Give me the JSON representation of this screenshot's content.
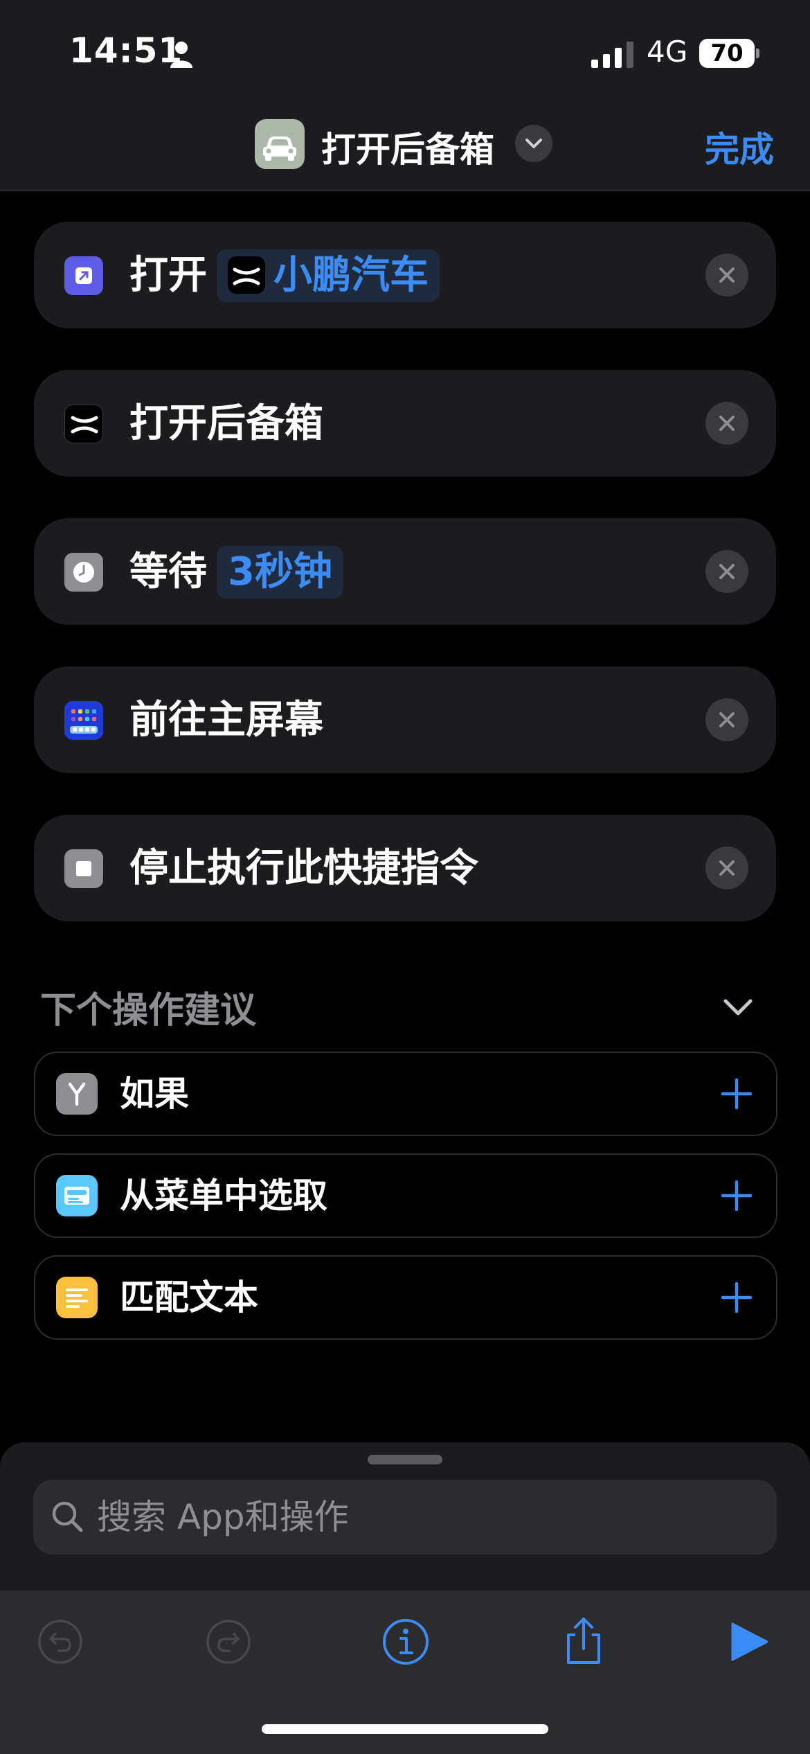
{
  "status_bar": {
    "time": "14:51",
    "network": "4G",
    "battery": "70"
  },
  "nav": {
    "title": "打开后备箱",
    "done_label": "完成"
  },
  "actions": [
    {
      "verb": "打开",
      "token": "小鹏汽车"
    },
    {
      "verb": "打开后备箱"
    },
    {
      "verb": "等待",
      "token": "3秒钟"
    },
    {
      "verb": "前往主屏幕"
    },
    {
      "verb": "停止执行此快捷指令"
    }
  ],
  "suggestions": {
    "header": "下个操作建议",
    "items": [
      {
        "label": "如果",
        "icon": "branch-icon",
        "color": "#8e8e93"
      },
      {
        "label": "从菜单中选取",
        "icon": "menu-icon",
        "color": "#5ac8fa"
      },
      {
        "label": "匹配文本",
        "icon": "text-icon",
        "color": "#f7c13b"
      }
    ]
  },
  "search": {
    "placeholder": "搜索 App和操作"
  },
  "colors": {
    "accent": "#3b8cf5",
    "card": "#1c1c1e",
    "background": "#000000"
  }
}
